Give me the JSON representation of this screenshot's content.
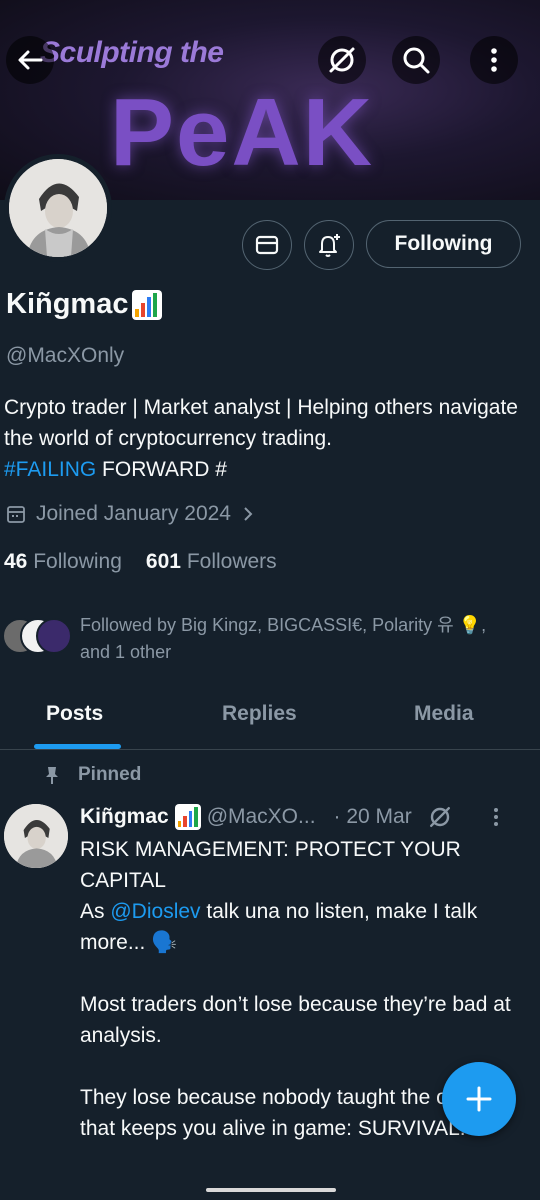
{
  "banner": {
    "line1": "Sculpting the",
    "line2": "PeAK"
  },
  "header": {
    "back_label": "←"
  },
  "profile": {
    "name": "Kiñgmac",
    "handle": "@MacXOnly",
    "bio_line": "Crypto trader | Market analyst | Helping others navigate the world of cryptocurrency trading.",
    "bio_hashtag": "#FAILING",
    "bio_tail": "FORWARD #",
    "joined": "Joined January 2024",
    "following_count": "46",
    "following_label": "Following",
    "followers_count": "601",
    "followers_label": "Followers",
    "followed_by": "Followed by Big Kingz, BIGCASSI€, Polarity 유 💡, and 1 other",
    "following_button": "Following"
  },
  "tabs": [
    {
      "label": "Posts",
      "active": true
    },
    {
      "label": "Replies",
      "active": false
    },
    {
      "label": "Media",
      "active": false
    }
  ],
  "post": {
    "pinned_label": "Pinned",
    "author_name": "Kiñgmac",
    "author_handle": "@MacXO...",
    "date": "· 20 Mar",
    "line1": "RISK MANAGEMENT: PROTECT YOUR CAPITAL",
    "line2_pre": "As",
    "line2_mention": "@Dioslev",
    "line2_post": "talk una no listen, make I talk more... 🗣️",
    "para2": "Most traders don’t lose because they’re bad at analysis.",
    "para3": "They lose because nobody taught the one rule that keeps you alive in game: SURVIVAL."
  },
  "fab_label": "+",
  "colors": {
    "background": "#15202b",
    "accent": "#1d9bf0",
    "muted": "#8b98a5"
  }
}
